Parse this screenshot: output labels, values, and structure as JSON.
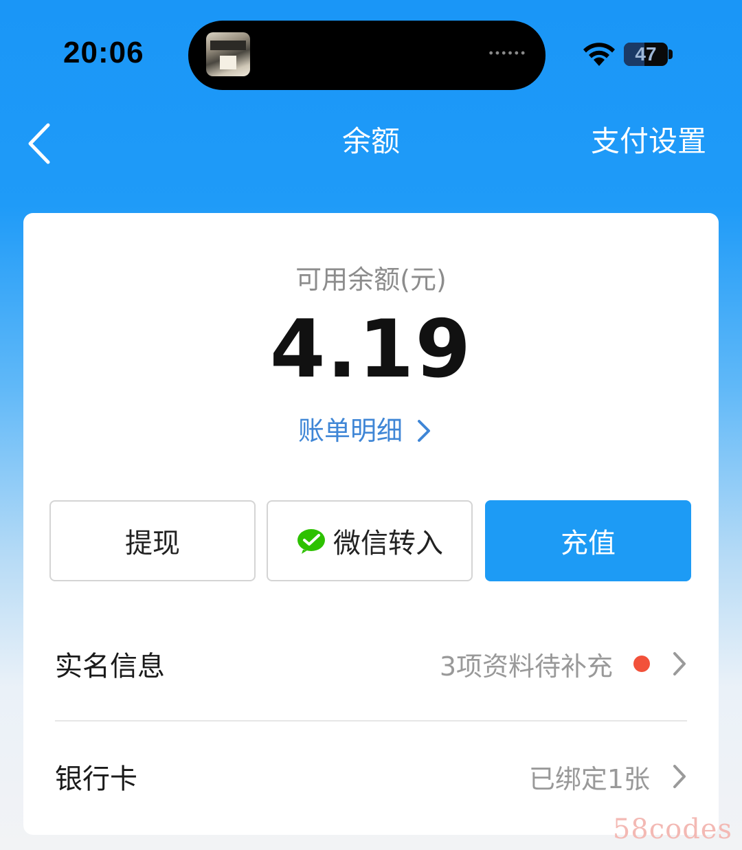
{
  "status_bar": {
    "time": "20:06",
    "battery_level": "47",
    "battery_fraction": 0.47,
    "icons": [
      "wifi-icon",
      "battery-icon",
      "now-playing-artwork"
    ]
  },
  "nav": {
    "back_icon": "chevron-left-icon",
    "title": "余额",
    "settings_label": "支付设置"
  },
  "balance": {
    "label": "可用余额(元)",
    "amount": "4.19",
    "bill_link": "账单明细"
  },
  "actions": {
    "withdraw": "提现",
    "wechat_transfer": "微信转入",
    "recharge": "充值"
  },
  "rows": {
    "real_name": {
      "label": "实名信息",
      "value": "3项资料待补充"
    },
    "bank_card": {
      "label": "银行卡",
      "value": "已绑定1张"
    }
  },
  "watermark": "58codes",
  "colors": {
    "primary_blue": "#1d9bf5",
    "link_blue": "#3f86d6",
    "alert_red": "#f2513a",
    "wechat_green": "#2dc100"
  }
}
